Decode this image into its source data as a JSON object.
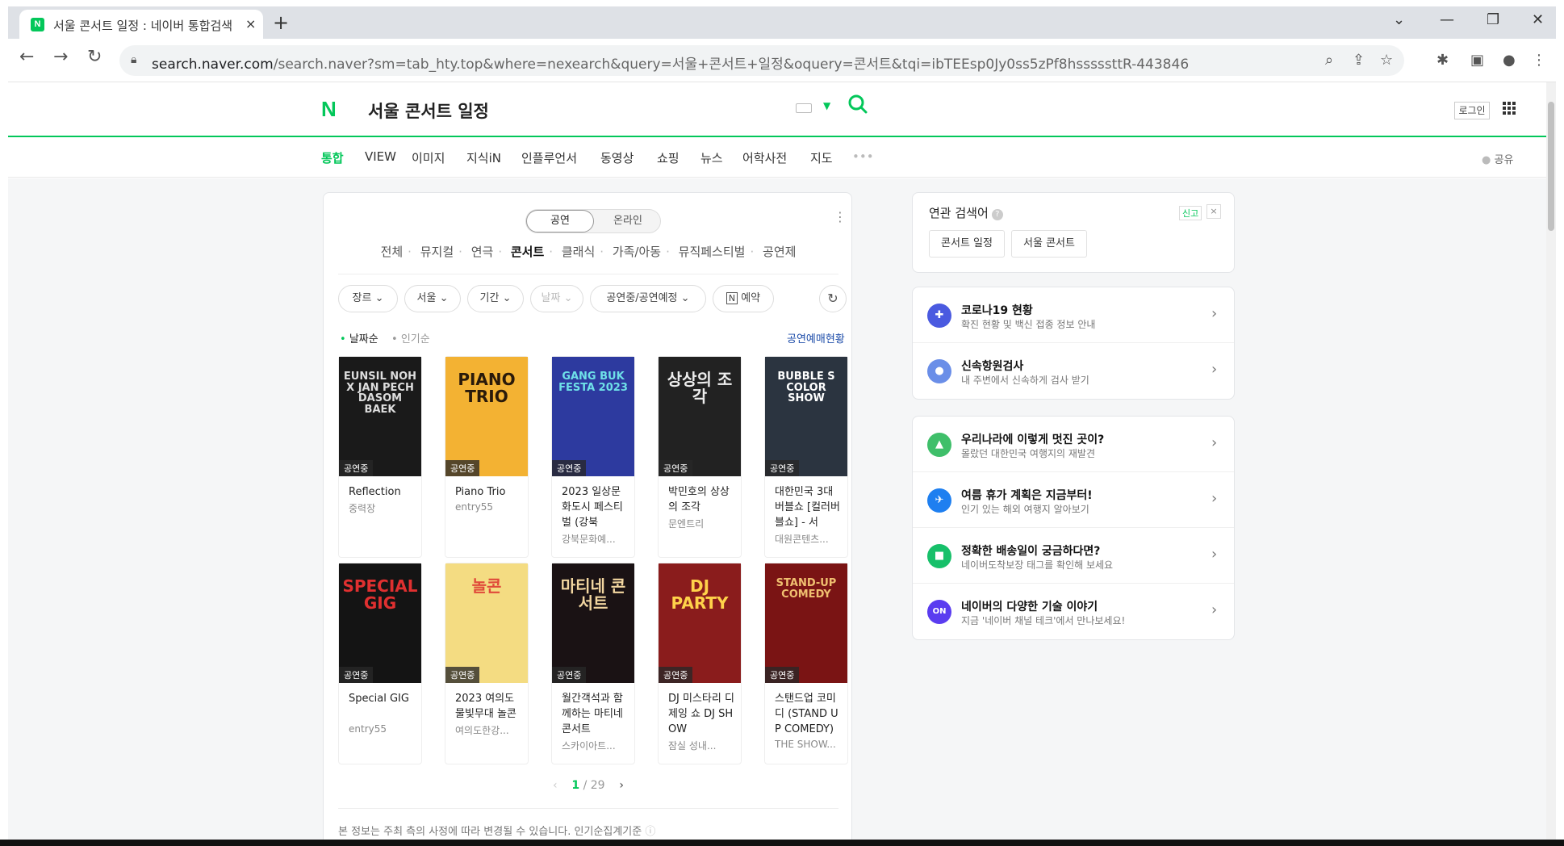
{
  "browser": {
    "tab_title": "서울 콘서트 일정 : 네이버 통합검색",
    "tab_favicon": "N",
    "tab_close": "×",
    "new_tab": "+",
    "url_domain": "search.naver.com",
    "url_path": "/search.naver?sm=tab_hty.top&where=nexearch&query=서울+콘서트+일정&oquery=콘서트&tqi=ibTEEsp0Jy0ss5zPf8hsssssttR-443846"
  },
  "header": {
    "logo": "N",
    "query": "서울 콘서트 일정",
    "login_label": "로그인"
  },
  "nav_tabs": [
    {
      "label": "통합",
      "active": true
    },
    {
      "label": "VIEW"
    },
    {
      "label": "이미지"
    },
    {
      "label": "지식iN"
    },
    {
      "label": "인플루언서"
    },
    {
      "label": "동영상"
    },
    {
      "label": "쇼핑"
    },
    {
      "label": "뉴스"
    },
    {
      "label": "어학사전"
    },
    {
      "label": "지도"
    },
    {
      "label": "•••"
    }
  ],
  "share_label": "공유",
  "performance": {
    "segments": [
      "공연",
      "온라인"
    ],
    "categories": [
      "전체",
      "뮤지컬",
      "연극",
      "콘서트",
      "클래식",
      "가족/아동",
      "뮤직페스티벌",
      "공연제"
    ],
    "active_category": "콘서트",
    "filters": [
      "장르",
      "서울",
      "기간",
      "날짜",
      "공연중/공연예정",
      "예약"
    ],
    "sort": [
      "날짜순",
      "인기순"
    ],
    "presale_link": "공연예매현황",
    "items": [
      {
        "title": "Reflection",
        "sub": "중력장",
        "badge": "공연중",
        "poster_text": "EUNSIL NOH X JAN PECH DASOM BAEK",
        "bg": "#1a1a1a",
        "fg": "#dddddd"
      },
      {
        "title": "Piano Trio",
        "sub": "entry55",
        "badge": "공연중",
        "poster_text": "PIANO TRIO",
        "bg": "#f3b233",
        "fg": "#2a1a0a"
      },
      {
        "title": "2023 일상문화도시 페스티벌 (강북",
        "sub": "강북문화예...",
        "badge": "공연중",
        "poster_text": "GANG BUK FESTA 2023",
        "bg": "#2d3a9f",
        "fg": "#6ee0e8"
      },
      {
        "title": "박민호의 상상의 조각",
        "sub": "문엔트리",
        "badge": "공연중",
        "poster_text": "상상의 조각",
        "bg": "#222222",
        "fg": "#eeeeee"
      },
      {
        "title": "대한민국 3대 버블쇼 [컬러버블쇼] - 서",
        "sub": "대원콘텐츠...",
        "badge": "공연중",
        "poster_text": "BUBBLE S COLOR SHOW",
        "bg": "#2b3440",
        "fg": "#ffffff"
      },
      {
        "title": "Special GIG",
        "sub": "entry55",
        "badge": "공연중",
        "poster_text": "SPECIAL GIG",
        "bg": "#141414",
        "fg": "#e03030"
      },
      {
        "title": "2023 여의도 물빛무대 놀콘",
        "sub": "여의도한강...",
        "badge": "공연중",
        "poster_text": "놀콘",
        "bg": "#f4dc82",
        "fg": "#e04a3a"
      },
      {
        "title": "월간객석과 함께하는 마티네콘서트",
        "sub": "스카이아트...",
        "badge": "공연중",
        "poster_text": "마티네 콘서트",
        "bg": "#1a1214",
        "fg": "#f2d6a0"
      },
      {
        "title": "DJ 미스타리 디제잉 쇼 DJ SHOW",
        "sub": "잠실 성내...",
        "badge": "공연중",
        "poster_text": "DJ PARTY",
        "bg": "#8a1c1c",
        "fg": "#ffd24a"
      },
      {
        "title": "스탠드업 코미디 (STAND UP COMEDY)",
        "sub": "THE SHOW...",
        "badge": "공연중",
        "poster_text": "STAND-UP COMEDY",
        "bg": "#7a1414",
        "fg": "#f0c070"
      }
    ],
    "page_current": "1",
    "page_sep": "/",
    "page_total": "29",
    "notice": "본 정보는 주최 측의 사정에 따라 변경될 수 있습니다. 인기순집계기준"
  },
  "related": {
    "title": "연관 검색어",
    "report": "신고",
    "close": "×",
    "chips": [
      "콘서트 일정",
      "서울 콘서트"
    ]
  },
  "info_group_1": [
    {
      "title": "코로나19 현황",
      "sub": "확진 현황 및 백신 접종 정보 안내",
      "icon_color": "#4a5ae0",
      "icon_glyph": "✚"
    },
    {
      "title": "신속항원검사",
      "sub": "내 주변에서 신속하게 검사 받기",
      "icon_color": "#6a8ee8",
      "icon_glyph": "●"
    }
  ],
  "info_group_2": [
    {
      "title": "우리나라에 이렇게 멋진 곳이?",
      "sub": "몰랐던 대한민국 여행지의 재발견",
      "icon_color": "#3fbf6a",
      "icon_glyph": "▲"
    },
    {
      "title": "여름 휴가 계획은 지금부터!",
      "sub": "인기 있는 해외 여행지 알아보기",
      "icon_color": "#1e7ff0",
      "icon_glyph": "✈"
    },
    {
      "title": "정확한 배송일이 궁금하다면?",
      "sub": "네이버도착보장 태그를 확인해 보세요",
      "icon_color": "#17c06a",
      "icon_glyph": "■"
    },
    {
      "title": "네이버의 다양한 기술 이야기",
      "sub": "지금 '네이버 채널 테크'에서 만나보세요!",
      "icon_color": "#5a3cf0",
      "icon_glyph": "ON"
    }
  ],
  "colors": {
    "naver_green": "#03c75a",
    "link_blue": "#1a4aa8"
  }
}
